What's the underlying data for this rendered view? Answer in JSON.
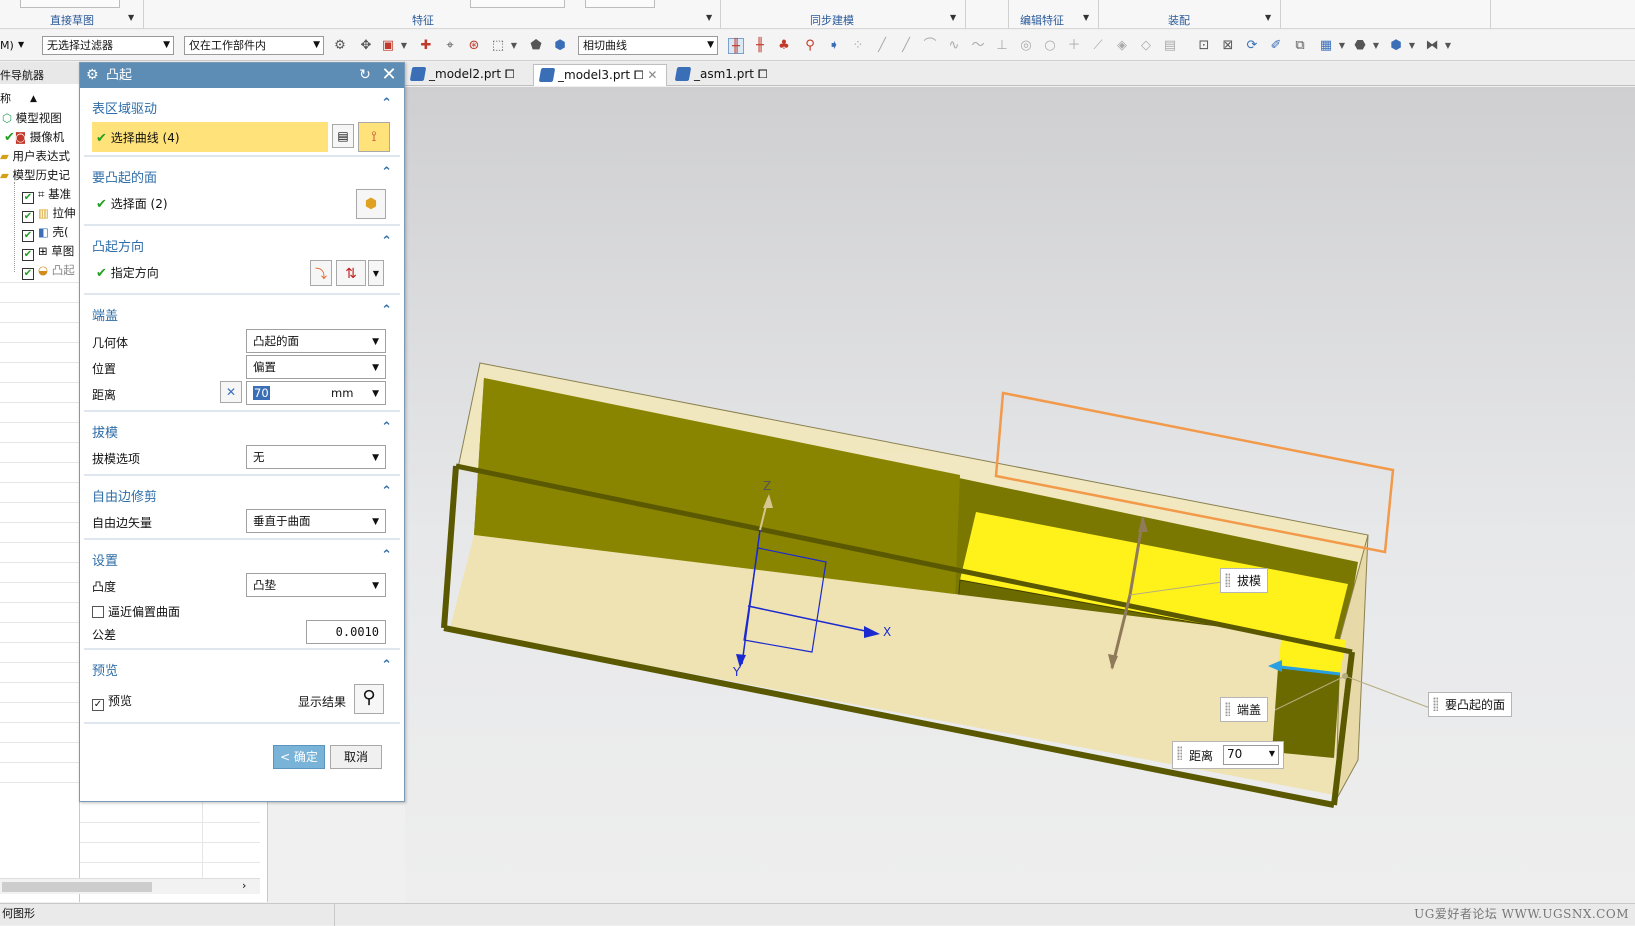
{
  "ribbon": {
    "groups": [
      "直接草图",
      "特征",
      "同步建模",
      "编辑特征",
      "装配"
    ]
  },
  "toolbar": {
    "menu_label": "M)",
    "filter_value": "无选择过滤器",
    "scope_value": "仅在工作部件内",
    "curve_rule_value": "相切曲线"
  },
  "navigator": {
    "title": "件导航器",
    "column_name": "称",
    "items": [
      {
        "label": "模型视图"
      },
      {
        "label": "摄像机"
      },
      {
        "label": "用户表达式"
      },
      {
        "label": "模型历史记"
      },
      {
        "label": "基准"
      },
      {
        "label": "拉伸"
      },
      {
        "label": "壳("
      },
      {
        "label": "草图"
      },
      {
        "label": "凸起"
      }
    ]
  },
  "dialog": {
    "title": "凸起",
    "sections": {
      "surface_drive": {
        "heading": "表区域驱动",
        "select_curve": "选择曲线 (4)"
      },
      "face": {
        "heading": "要凸起的面",
        "select_face": "选择面 (2)"
      },
      "direction": {
        "heading": "凸起方向",
        "specify": "指定方向"
      },
      "cap": {
        "heading": "端盖",
        "geometry_label": "几何体",
        "geometry_value": "凸起的面",
        "position_label": "位置",
        "position_value": "偏置",
        "distance_label": "距离",
        "distance_value": "70",
        "distance_unit": "mm"
      },
      "draft": {
        "heading": "拔模",
        "option_label": "拔模选项",
        "option_value": "无"
      },
      "free_edge": {
        "heading": "自由边修剪",
        "vector_label": "自由边矢量",
        "vector_value": "垂直于曲面"
      },
      "settings": {
        "heading": "设置",
        "convexity_label": "凸度",
        "convexity_value": "凸垫",
        "approx_label": "逼近偏置曲面",
        "tolerance_label": "公差",
        "tolerance_value": "0.0010"
      },
      "preview": {
        "heading": "预览",
        "preview_label": "预览",
        "show_result_label": "显示结果"
      }
    },
    "ok_label": "< 确定 >",
    "cancel_label": "取消"
  },
  "tabs": [
    {
      "label": "_model2.prt"
    },
    {
      "label": "_model3.prt"
    },
    {
      "label": "_asm1.prt"
    }
  ],
  "viewport": {
    "callouts": {
      "draft": "拔模",
      "cap": "端盖",
      "face": "要凸起的面",
      "distance_label": "距离",
      "distance_value": "70"
    },
    "axes": {
      "z": "Z",
      "x": "X",
      "y": "Y"
    },
    "triad": {
      "x": "X"
    }
  },
  "status": {
    "left_text": "何图形",
    "watermark": "UG爱好者论坛 WWW.UGSNX.COM"
  },
  "colors": {
    "dialog_title": "#5d8db4",
    "section_heading": "#2f6ea8",
    "selected_row": "#ffe27a",
    "ok_button": "#79b3d8",
    "body_dark": "#6b6a00",
    "body_light": "#f3e7b8",
    "pad_face": "#fff21a",
    "outline_orange": "#f29a4a"
  }
}
